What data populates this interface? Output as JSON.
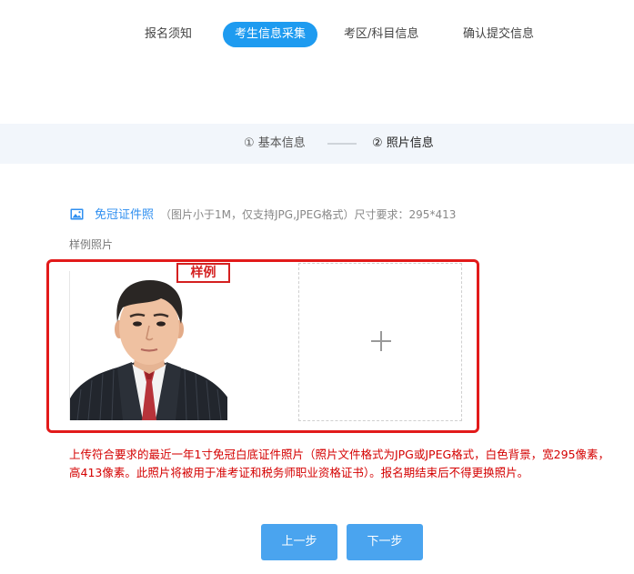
{
  "tabs": [
    {
      "label": "报名须知"
    },
    {
      "label": "考生信息采集",
      "active": true
    },
    {
      "label": "考区/科目信息"
    },
    {
      "label": "确认提交信息"
    }
  ],
  "steps": [
    {
      "label": "① 基本信息"
    },
    {
      "label": "② 照片信息",
      "active": true
    }
  ],
  "photo_section": {
    "icon": "image-icon",
    "title": "免冠证件照",
    "note": "（图片小于1M，仅支持JPG,JPEG格式）尺寸要求：295*413",
    "sample_label": "样例照片",
    "sample_tag": "样例",
    "upload_icon": "plus-icon"
  },
  "requirement_text": "上传符合要求的最近一年1寸免冠白底证件照片（照片文件格式为JPG或JPEG格式，白色背景，宽295像素，高413像素。此照片将被用于准考证和税务师职业资格证书）。报名期结束后不得更换照片。",
  "buttons": {
    "prev": "上一步",
    "next": "下一步"
  },
  "colors": {
    "accent": "#1e9bf0",
    "button": "#4aa4ef",
    "warning": "#d40000",
    "highlight_border": "#e21a1a"
  }
}
